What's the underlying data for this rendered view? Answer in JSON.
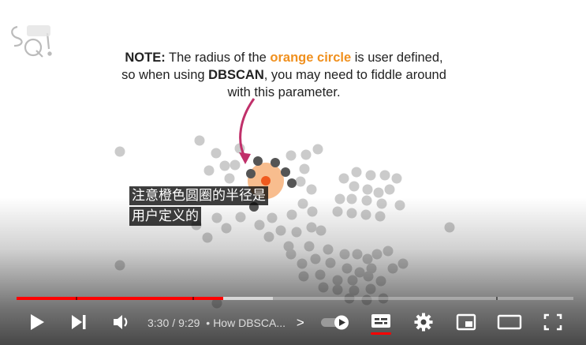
{
  "note": {
    "prefix": "NOTE:",
    "part1": " The radius of the ",
    "highlight": "orange circle",
    "part2": " is user defined, so when using ",
    "bold2": "DBSCAN",
    "part3": ", you may need to fiddle around with this parameter."
  },
  "subtitles": [
    "注意橙色圆圈的半径是",
    "用户定义的"
  ],
  "logo_text": "StatQuest",
  "controls": {
    "current_time": "3:30",
    "separator": "/",
    "duration": "9:29",
    "chapter": "How DBSCA...",
    "chapter_arrow": ">",
    "icons": [
      "play-icon",
      "next-icon",
      "volume-icon",
      "autoplay-toggle-icon",
      "subtitles-icon",
      "settings-icon",
      "miniplayer-icon",
      "theater-icon",
      "fullscreen-icon"
    ]
  },
  "progress": {
    "played_fraction": 0.371,
    "buffered_fraction": 0.46
  },
  "colors": {
    "accent_red": "#ff0000",
    "orange": "#f0901e",
    "arrow": "#c0306a",
    "dot_gray": "#c9c9c9",
    "dot_dark": "#555555"
  }
}
